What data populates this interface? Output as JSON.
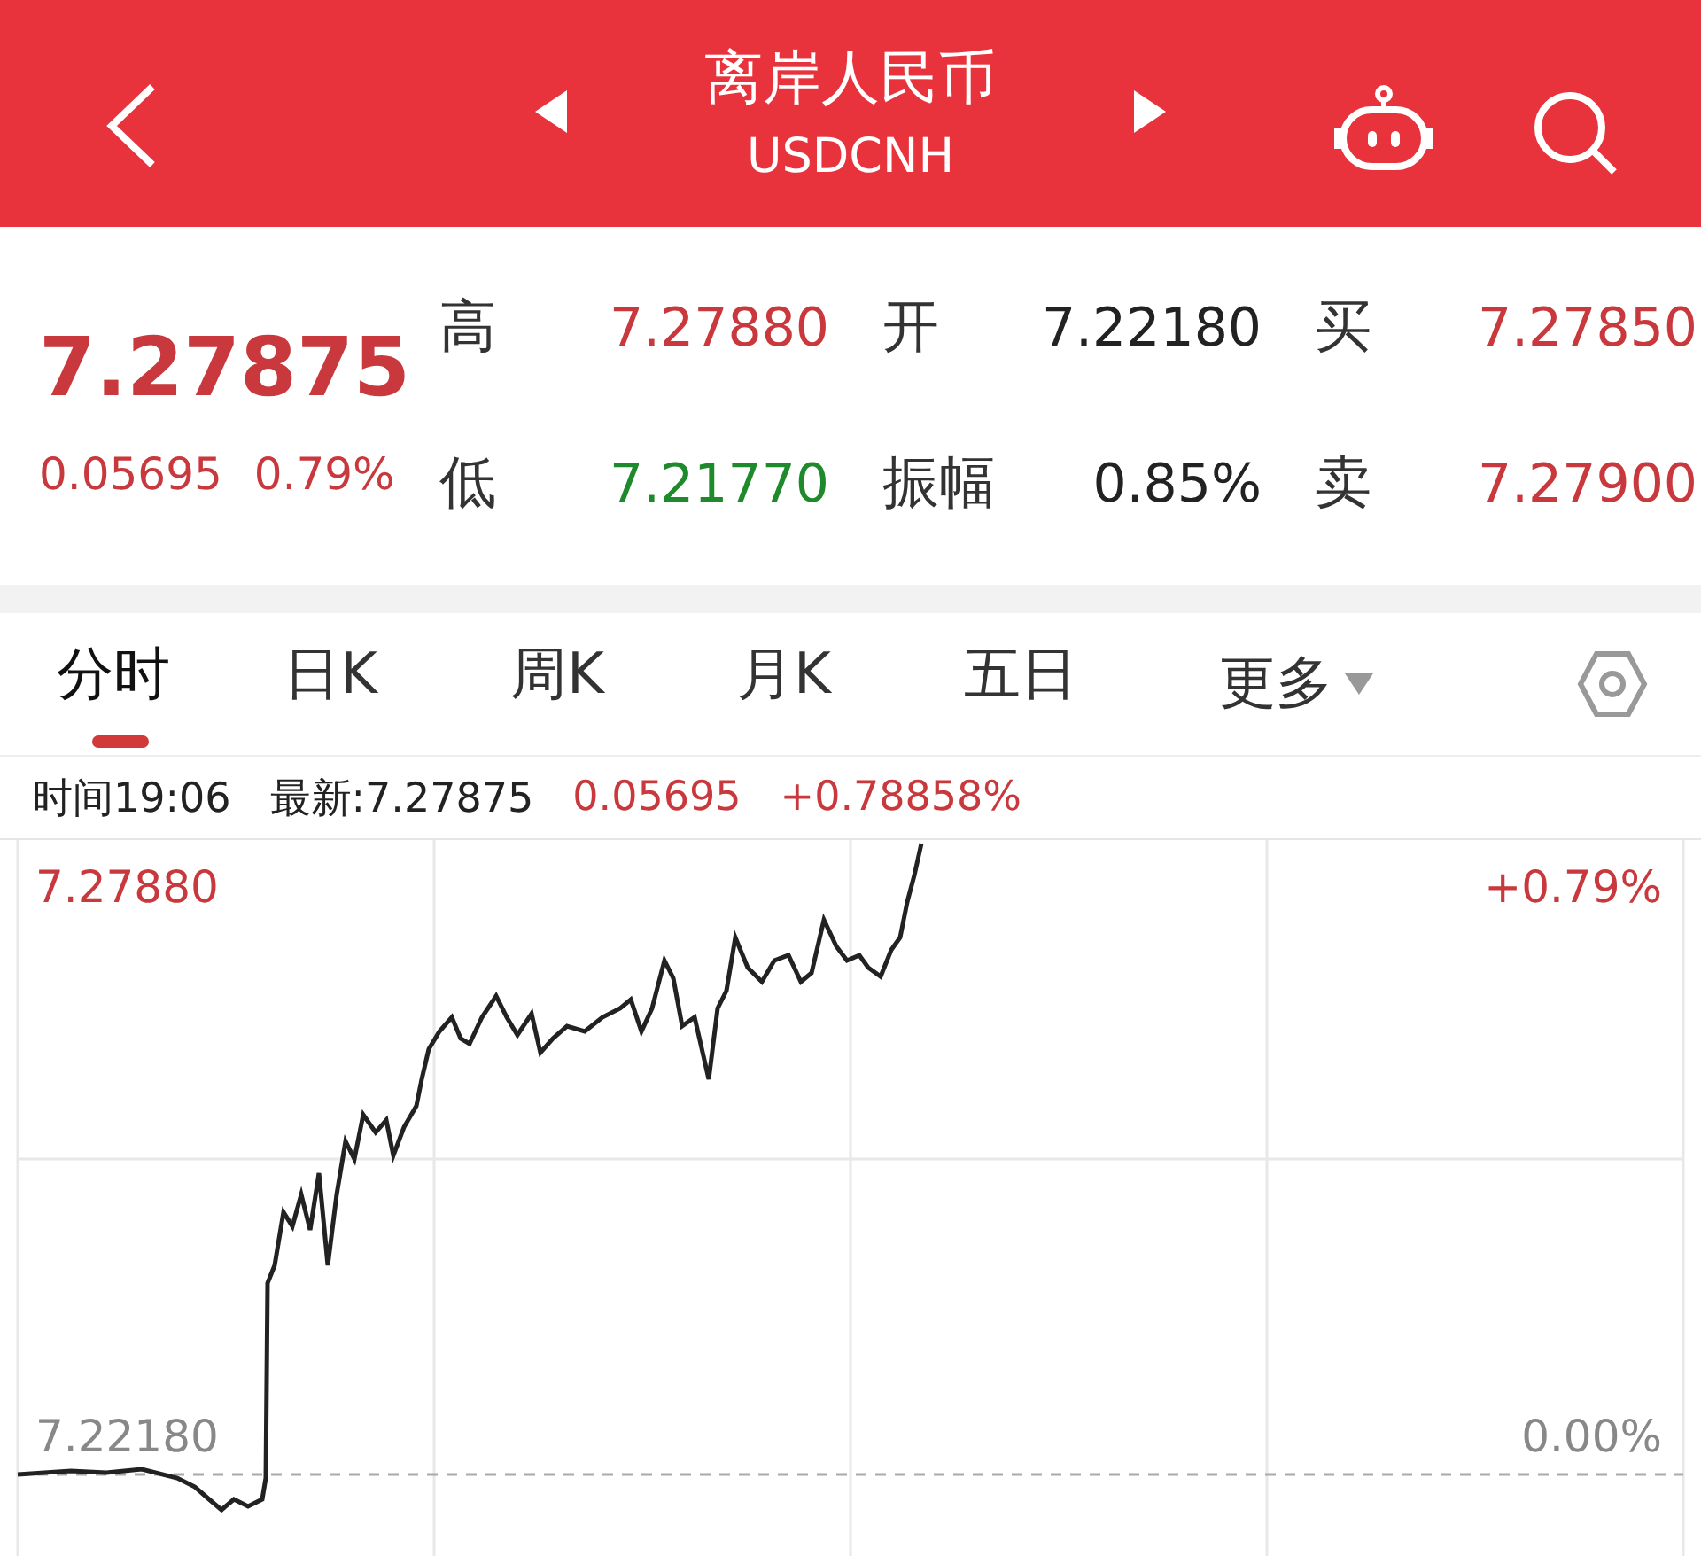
{
  "header": {
    "title": "离岸人民币",
    "code": "USDCNH"
  },
  "quote": {
    "price": "7.27875",
    "change": "0.05695",
    "change_pct": "0.79%",
    "stats": [
      {
        "label": "高",
        "value": "7.27880",
        "color": "#c8383c"
      },
      {
        "label": "开",
        "value": "7.22180",
        "color": "#222222"
      },
      {
        "label": "买",
        "value": "7.27850",
        "color": "#c8383c"
      },
      {
        "label": "低",
        "value": "7.21770",
        "color": "#1f8a2c"
      },
      {
        "label": "振幅",
        "value": "0.85%",
        "color": "#222222"
      },
      {
        "label": "卖",
        "value": "7.27900",
        "color": "#c8383c"
      }
    ]
  },
  "tabs": [
    {
      "label": "分时",
      "selected": true
    },
    {
      "label": "日K",
      "selected": false
    },
    {
      "label": "周K",
      "selected": false
    },
    {
      "label": "月K",
      "selected": false
    },
    {
      "label": "五日",
      "selected": false
    }
  ],
  "more_menu": {
    "label": "更多"
  },
  "info": {
    "time": "时间19:06",
    "latest": "最新:7.27875",
    "change": "0.05695",
    "change_pct": "+0.78858%"
  },
  "chart": {
    "top_price": "7.27880",
    "top_pct": "+0.79%",
    "base_price": "7.22180",
    "base_pct": "0.00%"
  }
}
